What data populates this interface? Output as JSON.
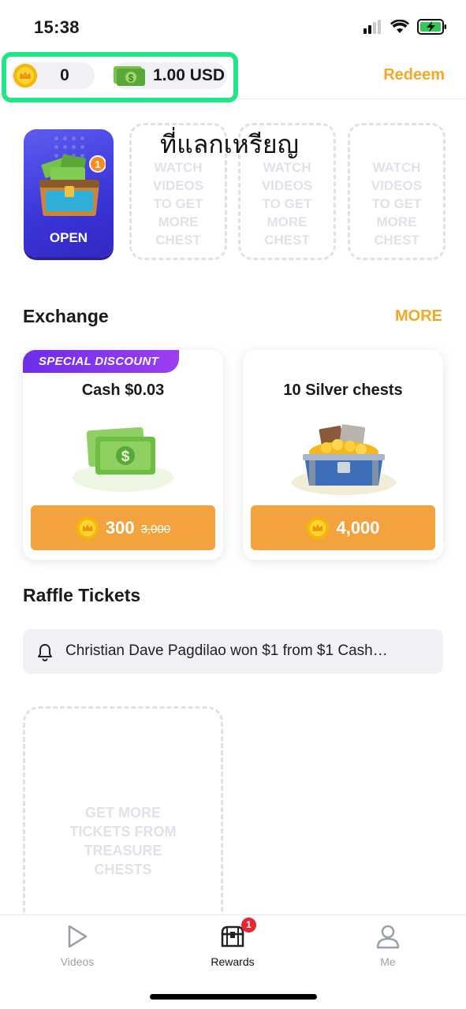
{
  "status_bar": {
    "time": "15:38"
  },
  "header": {
    "coin_balance": "0",
    "cash_balance": "1.00 USD",
    "redeem_label": "Redeem"
  },
  "chests": {
    "open_label": "OPEN",
    "open_badge": "1",
    "overlay_title": "ที่แลกเหรียญ",
    "slots": [
      {
        "text": "WATCH VIDEOS TO GET MORE CHEST"
      },
      {
        "text": "WATCH VIDEOS TO GET MORE CHEST"
      },
      {
        "text": "WATCH VIDEOS TO GET MORE CHEST"
      }
    ]
  },
  "exchange": {
    "title": "Exchange",
    "more_label": "MORE",
    "cards": [
      {
        "badge": "SPECIAL DISCOUNT",
        "title": "Cash $0.03",
        "price": "300",
        "old_price": "3,000"
      },
      {
        "title": "10 Silver chests",
        "price": "4,000"
      }
    ]
  },
  "raffle": {
    "title": "Raffle Tickets",
    "ticker_text": "Christian Dave Pagdilao won $1 from $1 Cash…",
    "empty_text": "GET MORE TICKETS FROM TREASURE CHESTS"
  },
  "tab_bar": {
    "items": [
      {
        "label": "Videos",
        "icon": "play-icon",
        "active": false
      },
      {
        "label": "Rewards",
        "icon": "treasure-chest-icon",
        "active": true,
        "badge": "1"
      },
      {
        "label": "Me",
        "icon": "person-icon",
        "active": false
      }
    ]
  },
  "colors": {
    "accent": "#f2a925",
    "button": "#f2a33d",
    "highlight": "#22e58a",
    "discount_badge": "#7a33ec",
    "chest_bg": "#4a43e0"
  }
}
